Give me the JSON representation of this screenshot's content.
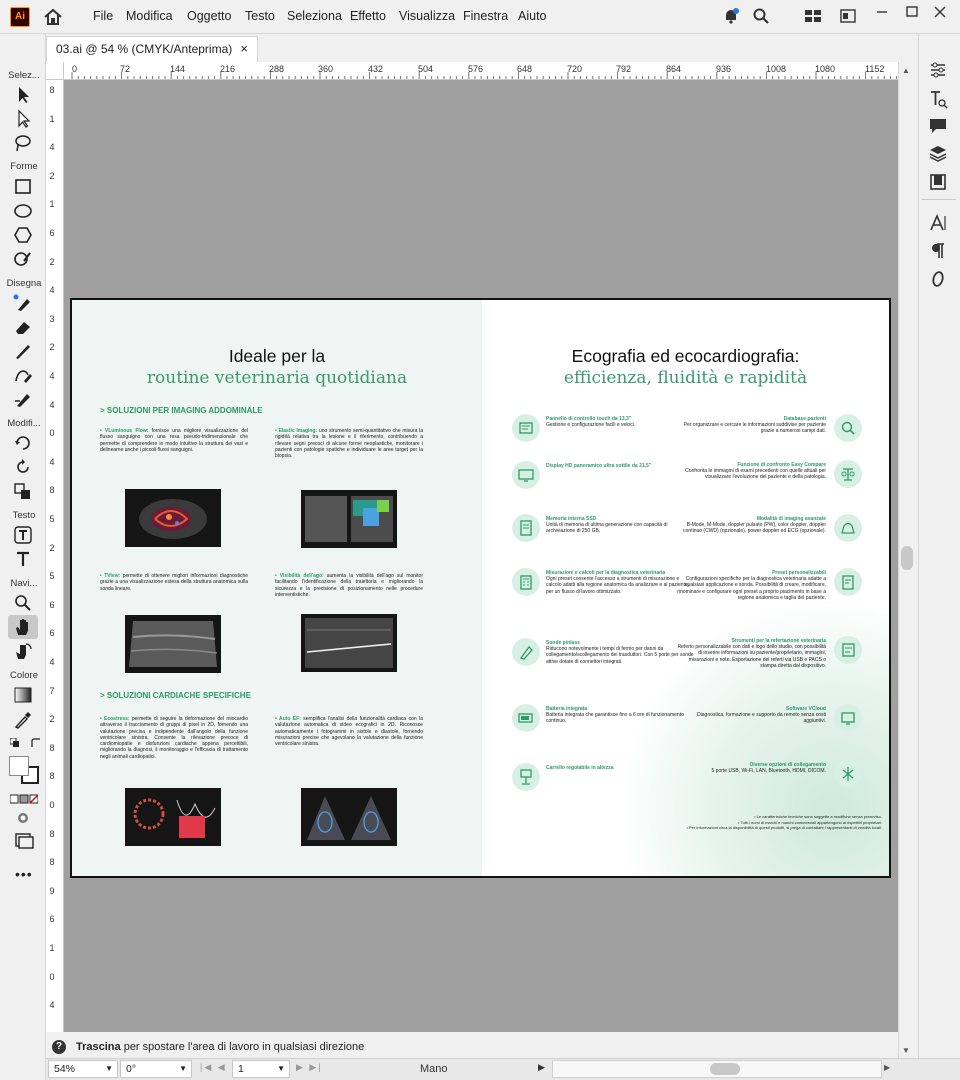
{
  "app": {
    "logo": "Ai"
  },
  "menu": [
    "File",
    "Modifica",
    "Oggetto",
    "Testo",
    "Seleziona",
    "Effetto",
    "Visualizza",
    "Finestra",
    "Aiuto"
  ],
  "tab": {
    "title": "03.ai @ 54 % (CMYK/Anteprima)",
    "close": "×"
  },
  "toolbar_groups": [
    "Selez...",
    "Forme",
    "Disegna",
    "Modifi...",
    "Testo",
    "Navi...",
    "Colore"
  ],
  "ruler_top": [
    "0",
    "72",
    "144",
    "216",
    "288",
    "360",
    "432",
    "504",
    "576",
    "648",
    "720",
    "792",
    "864",
    "936",
    "1008",
    "1080",
    "1152"
  ],
  "ruler_left": [
    "8",
    "1",
    "4",
    "2",
    "1",
    "6",
    "2",
    "4",
    "3",
    "2",
    "4",
    "4",
    "0",
    "4",
    "8",
    "5",
    "2",
    "5",
    "6",
    "6",
    "4",
    "7",
    "2",
    "8",
    "8",
    "0",
    "8",
    "8",
    "9",
    "6",
    "1",
    "0",
    "4"
  ],
  "hint": {
    "bold": "Trascina",
    "text": " per spostare l'area di lavoro in qualsiasi direzione"
  },
  "status": {
    "zoom": "54%",
    "rotation": "0°",
    "artboard": "1",
    "tool": "Mano"
  },
  "doc": {
    "left_title": "Ideale per la",
    "left_subtitle": "routine veterinaria quotidiana",
    "sec1": "> SOLUZIONI PER IMAGING ADDOMINALE",
    "sec2": "> SOLUZIONI CARDIACHE SPECIFICHE",
    "p1_b": "• VLuminous Flow:",
    "p1": " fornisce una migliore visualizzazione del flusso sanguigno con una resa pseudo-tridimensionale che permette di comprendere in modo intuitivo la struttura dei vasi e delinearne anche i piccoli flussi sanguigni.",
    "p2_b": "• Elastic Imaging:",
    "p2": " uno strumento semi-quantitativo che misura la rigidità relativa tra la lesione e il riferimento, contribuendo a rilevare segni precoci di alcune forme neoplastiche, monitorare i pazienti con patologie spatiche e individuare le aree target per la biopsia.",
    "p3_b": "• TView:",
    "p3": " permette di ottenere migliori informazioni diagnostiche grazie a una visualizzazione estesa della struttura anatomica sulla sonda lineare.",
    "p4_b": "• Visibilità dell'ago:",
    "p4": " aumenta la visibilità dell'ago sul monitor facilitando l'identificazione della traiettoria e migliorando la sicurezza e la precisione di posizionamento nelle procedure interventistiche.",
    "p5_b": "• Ecostress:",
    "p5": " permette di seguire la deformazione del miocardio attraverso il tracciamento di gruppi di pixel in 2D, fornendo una valutazione precisa e indipendente dall'angolo della funzione ventricolare sinistra. Consente la rilevazione precoce di cardiomiopatie e disfunzioni cardiache appena percettibili, migliorando la diagnosi, il monitoraggio e l'efficacia di trattamento negli animali cardiopatici.",
    "p6_b": "• Auto EF:",
    "p6": " semplifica l'analisi della funzionalità cardiaca con la valutazione automatica di video ecografici in 2D. Riconosce automaticamente i fotogrammi in sistole e diastole, fornendo misurazioni precise che agevolano la valutazione della funzione ventricolare sinistra.",
    "right_title": "Ecografia ed ecocardiografia:",
    "right_subtitle": "efficienza, fluidità e rapidità",
    "features_left": [
      {
        "t": "Pannello di controllo touch da 13,3\"",
        "d": "Gestione e configurazione facili e veloci."
      },
      {
        "t": "Display HD panoramico ultra sottile da 21,5\"",
        "d": ""
      },
      {
        "t": "Memoria interna SSD",
        "d": "Unità di memoria di ultima generazione con capacità di archiviazione di 250 GB."
      },
      {
        "t": "Misurazioni e calcoli per la diagnostica veterinaria",
        "d": "Ogni preset consente l'accesso a strumenti di misurazione e calcolo adatti alla regione anatomica da analizzare e al paziente, per un flusso di lavoro ottimizzato."
      },
      {
        "t": "Sonde pinlass",
        "d": "Riducono notevolmente i tempi di fermo per danni da collegamento/scollegamento dei trasduttori. Con 5 porte per sonde attive dotate di connettori integrati."
      },
      {
        "t": "Batteria integrata",
        "d": "Batteria integrata che garantisce fino a 6 ore di funzionamento continuo."
      },
      {
        "t": "Carrello regolabile in altezza",
        "d": ""
      }
    ],
    "features_right": [
      {
        "t": "Database pazienti",
        "d": "Per organizzare e cercare le informazioni suddivise per paziente grazie a numerosi campi dati."
      },
      {
        "t": "Funzione di confronto Easy Compare",
        "d": "Confronta le immagini di esami precedenti con quelle attuali per visualizzare l'evoluzione del paziente e della patologia."
      },
      {
        "t": "Modalità di imaging avanzate",
        "d": "B-Mode, M-Mode, doppler pulsato (PW), color doppler, doppler continuo (CWD) (opzionale), power doppler ed ECG (opzionale)."
      },
      {
        "t": "Preset personalizzabili",
        "d": "Configurazioni specifiche per la diagnostica veterinaria adatte a qualsiasi applicazione e sonda. Possibilità di creare, modificare, rinominare e configurare ogni preset a proprio piacimento in base a regione anatomica e taglia del paziente."
      },
      {
        "t": "Strumenti per la refertazione veterinaria",
        "d": "Referto personalizzabile con dati e logo dello studio, con possibilità di inserire informazioni su paziente/proprietario, immagini, misurazioni e note. Esportazione dei referti via USB e PACS o stampa diretta dal dispositivo."
      },
      {
        "t": "Software VCloud",
        "d": "Diagnostica, formazione e supporto da remoto senza costi aggiuntivi."
      },
      {
        "t": "Diverse opzioni di collegamento",
        "d": "5 porte USB, Wi-Fi, LAN, Bluetooth, HDMI, DICOM."
      }
    ],
    "footnotes": [
      "• Le caratteristiche tecniche sono soggette a modifiche senza preavviso.",
      "• Tutti i nomi di marchi e marchi commerciali appartengono ai rispettivi proprietari.",
      "• Per informazioni circa la disponibilità di questi prodotti, si prega di contattare i rappresentanti di vendita locali."
    ]
  }
}
